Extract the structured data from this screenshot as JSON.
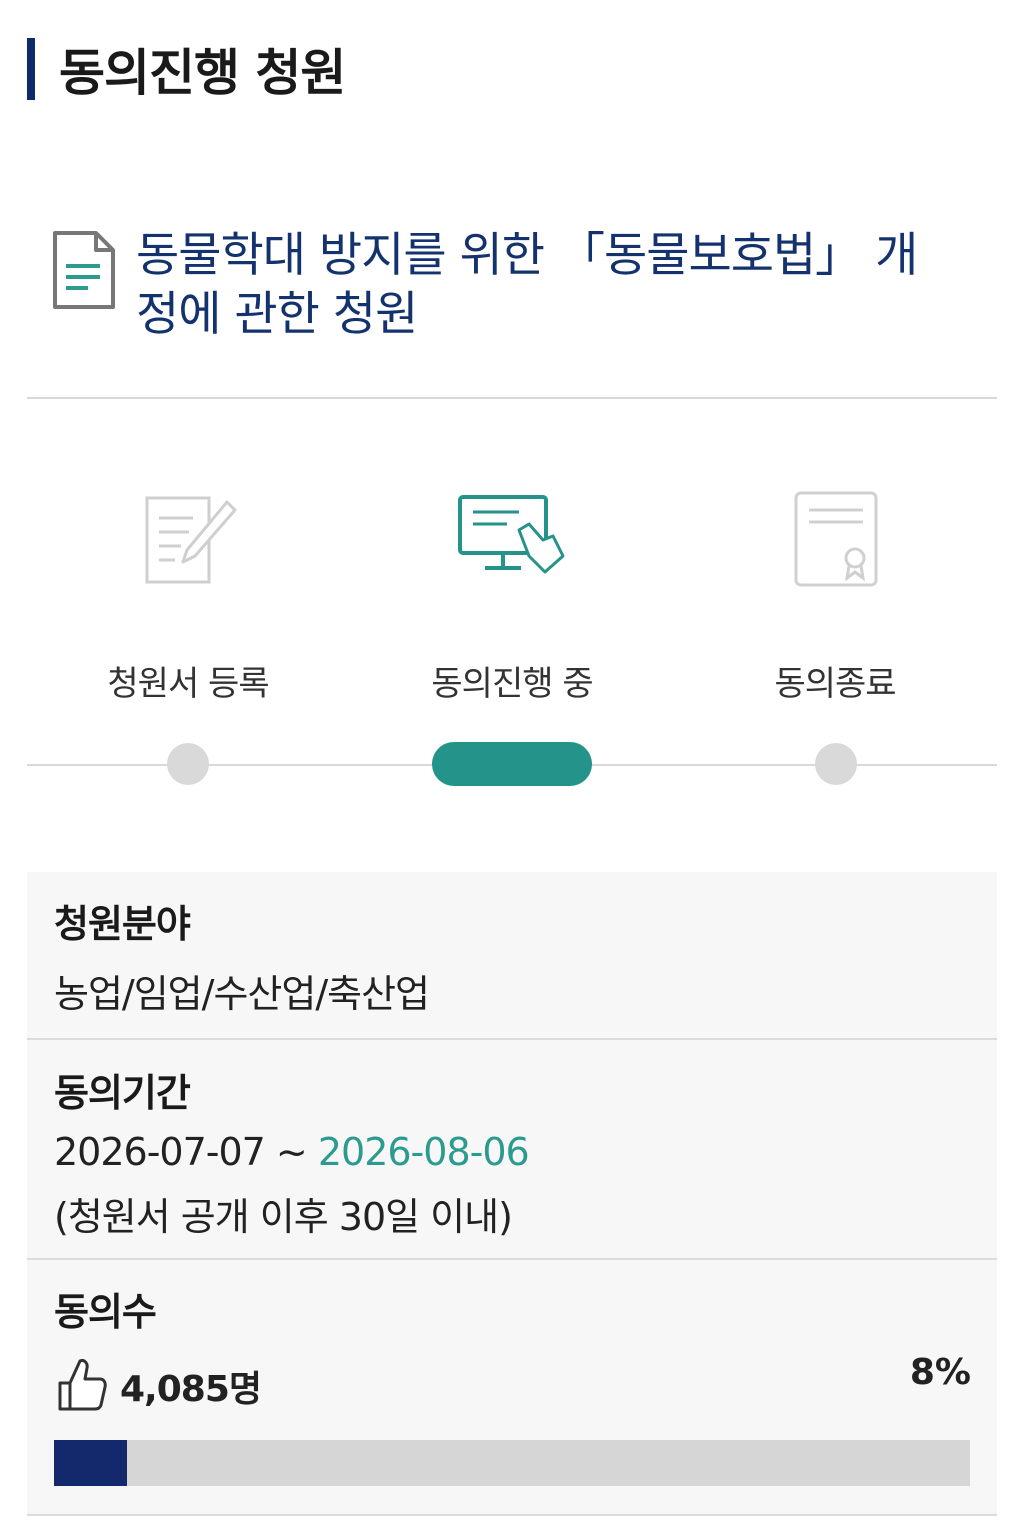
{
  "header": {
    "title": "동의진행 청원"
  },
  "petition": {
    "title": "동물학대 방지를 위한 「동물보호법」 개정에 관한 청원"
  },
  "steps": [
    {
      "label": "청원서 등록",
      "icon": "document-edit-icon",
      "active": false
    },
    {
      "label": "동의진행 중",
      "icon": "monitor-touch-icon",
      "active": true
    },
    {
      "label": "동의종료",
      "icon": "certificate-icon",
      "active": false
    }
  ],
  "info": {
    "field_label": "청원분야",
    "field_value": "농업/임업/수산업/축산업",
    "period_label": "동의기간",
    "period_start": "2026-07-07 ~ ",
    "period_end": "2026-08-06",
    "period_note": "(청원서 공개 이후 30일 이내)",
    "count_label": "동의수",
    "count_value": "4,085명",
    "percent_text": "8%",
    "percent": 8
  },
  "colors": {
    "accent": "#24938a",
    "brand": "#14286c",
    "title": "#14336e"
  }
}
